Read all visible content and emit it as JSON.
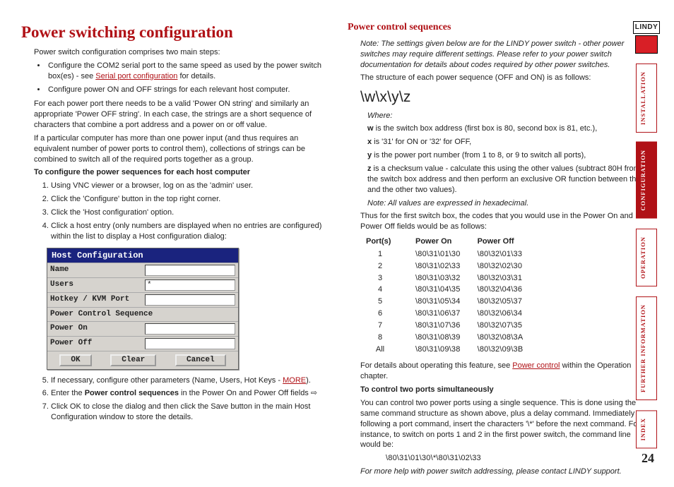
{
  "logo": "LINDY",
  "page_number": "24",
  "tabs": {
    "installation": "INSTALLATION",
    "configuration": "CONFIGURATION",
    "operation": "OPERATION",
    "further": "FURTHER INFORMATION",
    "index": "INDEX"
  },
  "left": {
    "h1": "Power switching configuration",
    "intro": "Power switch configuration comprises two main steps:",
    "bullet1a": "Configure the COM2 serial port to the same speed as used by the power switch box(es) - see ",
    "bullet1_link": "Serial port configuration",
    "bullet1b": " for details.",
    "bullet2": "Configure power ON and OFF strings for each relevant host computer.",
    "p1": "For each power port there needs to be a valid 'Power ON string' and similarly an appropriate 'Power OFF string'. In each case, the strings are a short sequence of characters that combine a port address and a power on or off value.",
    "p2": "If a particular computer has more than one power input (and thus requires an equivalent number of power ports to control them), collections of strings can be combined to switch all of the required ports together as a group.",
    "subhead": "To configure the power sequences for each host computer",
    "steps": {
      "s1": "Using VNC viewer or a browser, log on as the 'admin' user.",
      "s2": "Click the 'Configure' button in the top right corner.",
      "s3": "Click the 'Host configuration' option.",
      "s4": "Click a host entry (only numbers are displayed when no entries are configured) within the list to display a Host configuration dialog:",
      "s5a": "If necessary, configure other parameters (Name, Users, Hot Keys - ",
      "s5_link": "MORE",
      "s5b": ").",
      "s6a": "Enter the ",
      "s6_bold": "Power control sequences",
      "s6b": " in the Power On and Power Off fields ",
      "s6_arrow": "⇨",
      "s7": "Click OK to close the dialog and then click the Save button in the main Host Configuration window to store the details."
    },
    "dlg": {
      "title": "Host Configuration",
      "name": "Name",
      "users": "Users",
      "users_val": "*",
      "hotkey": "Hotkey / KVM Port",
      "pcs": "Power Control Sequence",
      "pon": "Power On",
      "poff": "Power Off",
      "ok": "OK",
      "clear": "Clear",
      "cancel": "Cancel"
    }
  },
  "right": {
    "h2": "Power control sequences",
    "note1": "Note: The settings given below are for the LINDY power switch - other power switches may require different settings. Please refer to your power switch documentation for details about codes required by other power switches.",
    "structline": "The structure of each power sequence (OFF and ON) is as follows:",
    "seq": "\\w\\x\\y\\z",
    "where_lbl": "Where:",
    "where": {
      "w_b": "w",
      "w_t": " is the switch box address (first box is 80, second box is 81, etc.),",
      "x_b": "x",
      "x_t": " is '31' for ON or '32' for OFF,",
      "y_b": "y",
      "y_t": " is the power port number (from 1 to 8, or 9 to switch all ports),",
      "z_b": "z",
      "z_t": " is a checksum value - calculate this using the other values (subtract 80H from the switch box address and then perform an exclusive OR function between this and the other two values)."
    },
    "note2": "Note: All values are expressed in hexadecimal.",
    "thus": "Thus for the first switch box, the codes that you would use in the Power On and Power Off fields would be as follows:",
    "th": {
      "port": "Port(s)",
      "on": "Power On",
      "off": "Power Off"
    },
    "rows": [
      {
        "port": "1",
        "on": "\\80\\31\\01\\30",
        "off": "\\80\\32\\01\\33"
      },
      {
        "port": "2",
        "on": "\\80\\31\\02\\33",
        "off": "\\80\\32\\02\\30"
      },
      {
        "port": "3",
        "on": "\\80\\31\\03\\32",
        "off": "\\80\\32\\03\\31"
      },
      {
        "port": "4",
        "on": "\\80\\31\\04\\35",
        "off": "\\80\\32\\04\\36"
      },
      {
        "port": "5",
        "on": "\\80\\31\\05\\34",
        "off": "\\80\\32\\05\\37"
      },
      {
        "port": "6",
        "on": "\\80\\31\\06\\37",
        "off": "\\80\\32\\06\\34"
      },
      {
        "port": "7",
        "on": "\\80\\31\\07\\36",
        "off": "\\80\\32\\07\\35"
      },
      {
        "port": "8",
        "on": "\\80\\31\\08\\39",
        "off": "\\80\\32\\08\\3A"
      },
      {
        "port": "All",
        "on": "\\80\\31\\09\\38",
        "off": "\\80\\32\\09\\3B"
      }
    ],
    "details_a": "For details about operating this feature, see ",
    "details_link": "Power control",
    "details_b": " within the Operation chapter.",
    "twoports_head": "To control two ports simultaneously",
    "twoports_body": "You can control two power ports using a single sequence. This is done using the same command structure as shown above, plus a delay command. Immediately following a port command, insert the characters '\\*' before the next command. For instance, to switch on ports 1 and 2 in the first power switch, the command line would be:",
    "cmd": "\\80\\31\\01\\30\\*\\80\\31\\02\\33",
    "helpline": "For more help with power switch addressing, please contact LINDY support."
  }
}
